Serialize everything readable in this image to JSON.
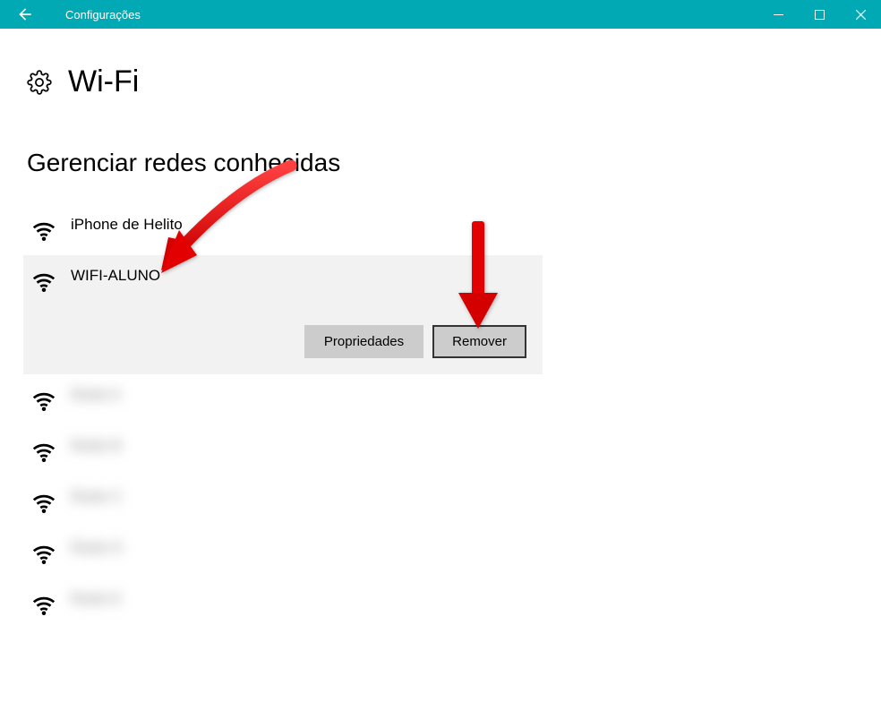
{
  "window": {
    "title": "Configurações"
  },
  "page": {
    "title": "Wi-Fi"
  },
  "section": {
    "title": "Gerenciar redes conhecidas"
  },
  "networks": [
    {
      "name": "iPhone de Helito",
      "selected": false,
      "blurred": false
    },
    {
      "name": "WIFI-ALUNO",
      "selected": true,
      "blurred": false
    },
    {
      "name": "Rede A",
      "selected": false,
      "blurred": true
    },
    {
      "name": "Rede B",
      "selected": false,
      "blurred": true
    },
    {
      "name": "Rede C",
      "selected": false,
      "blurred": true
    },
    {
      "name": "Rede D",
      "selected": false,
      "blurred": true
    },
    {
      "name": "Rede E",
      "selected": false,
      "blurred": true
    }
  ],
  "actions": {
    "properties": "Propriedades",
    "remove": "Remover"
  }
}
